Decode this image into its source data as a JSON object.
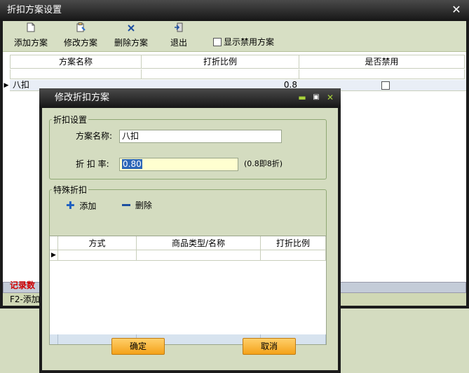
{
  "main": {
    "title": "折扣方案设置",
    "close_glyph": "✕",
    "toolbar": {
      "add_label": "添加方案",
      "edit_label": "修改方案",
      "delete_label": "删除方案",
      "exit_label": "退出",
      "show_disabled_label": "显示禁用方案"
    },
    "grid": {
      "columns": [
        "方案名称",
        "打折比例",
        "是否禁用"
      ],
      "rows": [
        {
          "name": "八扣",
          "rate": "0.8"
        }
      ]
    },
    "status_label": "记录数",
    "hint": "F2-添加"
  },
  "dialog": {
    "title": "修改折扣方案",
    "discount_group_label": "折扣设置",
    "scheme_name_label": "方案名称:",
    "scheme_name_value": "八扣",
    "rate_label": "折 扣 率:",
    "rate_value": "0.80",
    "rate_hint": "(0.8即8折)",
    "special_group_label": "特殊折扣",
    "add_label": "添加",
    "remove_label": "删除",
    "grid_columns": [
      "方式",
      "商品类型/名称",
      "打折比例"
    ],
    "ok_label": "确定",
    "cancel_label": "取消"
  },
  "colors": {
    "accent_green": "#a8d23a",
    "button_orange": "#f4a21a",
    "status_red": "#d00000"
  }
}
